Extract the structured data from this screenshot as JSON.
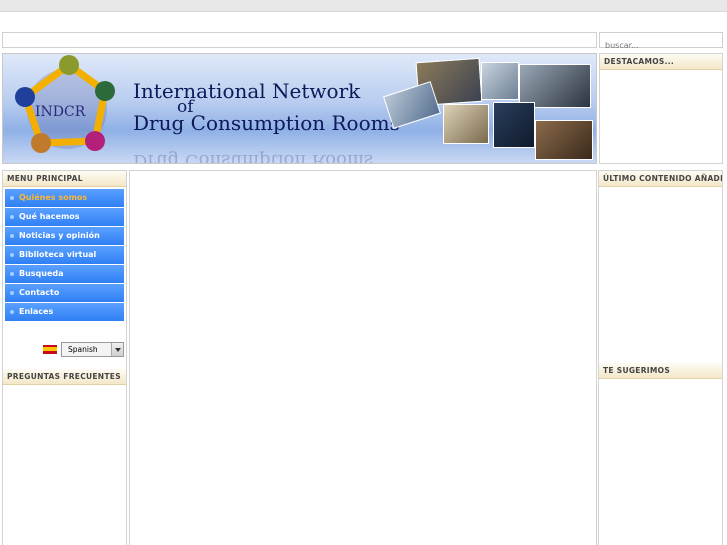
{
  "search": {
    "placeholder": "buscar..."
  },
  "banner": {
    "logo_text": "INDCR",
    "title_line1": "International Network",
    "title_line2": "of",
    "title_line3": "Drug Consumption Rooms"
  },
  "right": {
    "destacamos": "DESTACAMOS...",
    "ultimo": "ÚLTIMO CONTENIDO AÑADIDO",
    "sugerimos": "TE SUGERIMOS"
  },
  "left": {
    "menu_title": "MENU PRINCIPAL",
    "menu": [
      {
        "label": "Quiénes somos"
      },
      {
        "label": "Qué hacemos"
      },
      {
        "label": "Noticias y opinión"
      },
      {
        "label": "Biblioteca virtual"
      },
      {
        "label": "Busqueda"
      },
      {
        "label": "Contacto"
      },
      {
        "label": "Enlaces"
      }
    ],
    "language": "Spanish",
    "faq_title": "PREGUNTAS FRECUENTES"
  },
  "colors": {
    "menu_blue": "#2f7ff5",
    "active_item": "#ffb732",
    "header_beige": "#f4e7c8",
    "banner_navy": "#0c1a5a"
  }
}
